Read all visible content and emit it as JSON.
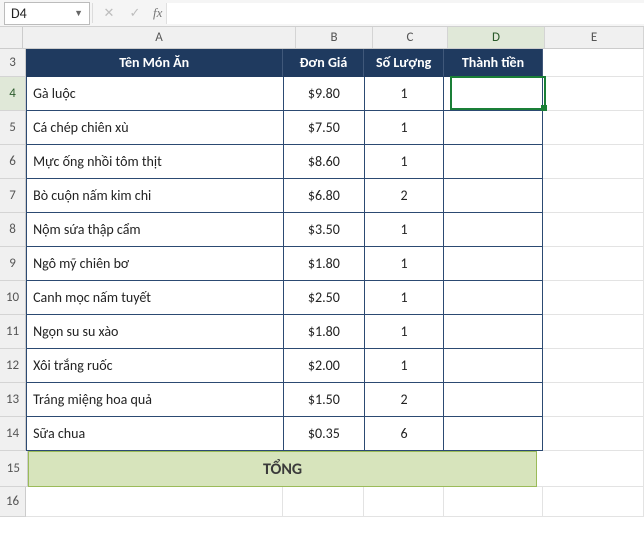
{
  "namebox": {
    "ref": "D4"
  },
  "columns": [
    "A",
    "B",
    "C",
    "D",
    "E"
  ],
  "col_widths_class": {
    "A": "wA",
    "B": "wB",
    "C": "wC",
    "D": "wD",
    "E": "wE"
  },
  "active": {
    "col": "D",
    "row": "4"
  },
  "header_row": "3",
  "headers": {
    "A": "Tên Món Ăn",
    "B": "Đơn Giá",
    "C": "Số Lượng",
    "D": "Thành tiền"
  },
  "data_rows": [
    "4",
    "5",
    "6",
    "7",
    "8",
    "9",
    "10",
    "11",
    "12",
    "13",
    "14"
  ],
  "table": {
    "4": {
      "A": "Gà luộc",
      "B": "$9.80",
      "C": "1",
      "D": ""
    },
    "5": {
      "A": "Cá chép chiên xù",
      "B": "$7.50",
      "C": "1",
      "D": ""
    },
    "6": {
      "A": "Mực ống nhồi tôm thịt",
      "B": "$8.60",
      "C": "1",
      "D": ""
    },
    "7": {
      "A": "Bò cuộn nấm kim chi",
      "B": "$6.80",
      "C": "2",
      "D": ""
    },
    "8": {
      "A": "Nộm sứa thập cẩm",
      "B": "$3.50",
      "C": "1",
      "D": ""
    },
    "9": {
      "A": "Ngô mỹ chiên bơ",
      "B": "$1.80",
      "C": "1",
      "D": ""
    },
    "10": {
      "A": "Canh mọc nấm tuyết",
      "B": "$2.50",
      "C": "1",
      "D": ""
    },
    "11": {
      "A": "Ngọn su su xào",
      "B": "$1.80",
      "C": "1",
      "D": ""
    },
    "12": {
      "A": "Xôi trắng ruốc",
      "B": "$2.00",
      "C": "1",
      "D": ""
    },
    "13": {
      "A": "Tráng miệng hoa quả",
      "B": "$1.50",
      "C": "2",
      "D": ""
    },
    "14": {
      "A": "Sữa chua",
      "B": "$0.35",
      "C": "6",
      "D": ""
    }
  },
  "total_row": {
    "row": "15",
    "label": "TỔNG"
  },
  "blank_rows": [
    "16"
  ],
  "colors": {
    "header_bg": "#1f3a5f",
    "total_bg": "#d7e4bc",
    "selection": "#1a7f37"
  }
}
